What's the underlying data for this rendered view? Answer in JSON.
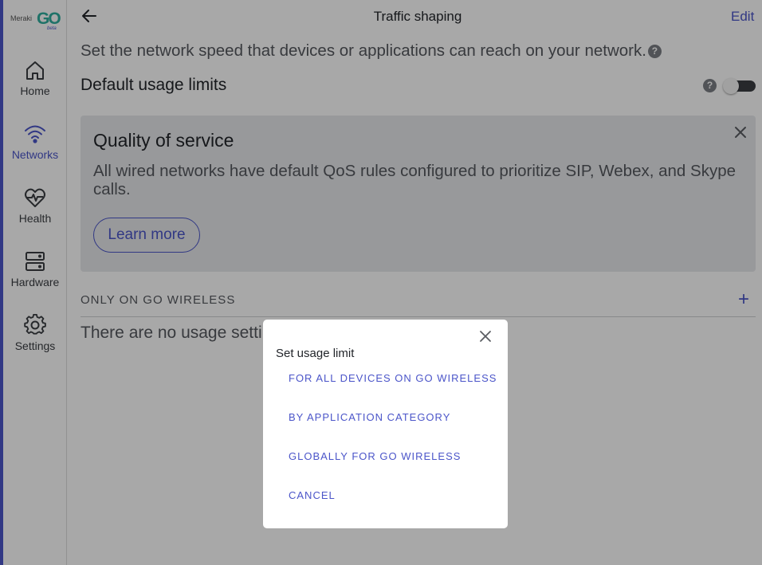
{
  "sidebar": {
    "logo": {
      "brand": "Meraki",
      "product": "GO",
      "tag": "beta"
    },
    "items": [
      {
        "label": "Home",
        "icon": "home-icon"
      },
      {
        "label": "Networks",
        "icon": "wifi-icon"
      },
      {
        "label": "Health",
        "icon": "heart-pulse-icon"
      },
      {
        "label": "Hardware",
        "icon": "server-icon"
      },
      {
        "label": "Settings",
        "icon": "gear-icon"
      }
    ],
    "active": "Networks"
  },
  "header": {
    "title": "Traffic shaping",
    "edit": "Edit",
    "back_icon": "arrow-left-icon"
  },
  "description": "Set the network speed that devices or applications can reach on your network.",
  "default_limits": {
    "label": "Default usage limits",
    "enabled": false
  },
  "qos_card": {
    "title": "Quality of service",
    "body": "All wired networks have default QoS rules configured to prioritize SIP, Webex, and Skype calls.",
    "learn_more": "Learn more"
  },
  "section": {
    "heading": "ONLY ON GO WIRELESS",
    "empty_text": "There are no usage settings"
  },
  "modal": {
    "title": "Set usage limit",
    "options": [
      "FOR ALL DEVICES ON GO WIRELESS",
      "BY APPLICATION CATEGORY",
      "GLOBALLY FOR GO WIRELESS",
      "CANCEL"
    ]
  },
  "colors": {
    "accent": "#4b55c9",
    "overlay": "rgba(0,0,0,0.34)",
    "logo_teal": "#2fae9f"
  }
}
